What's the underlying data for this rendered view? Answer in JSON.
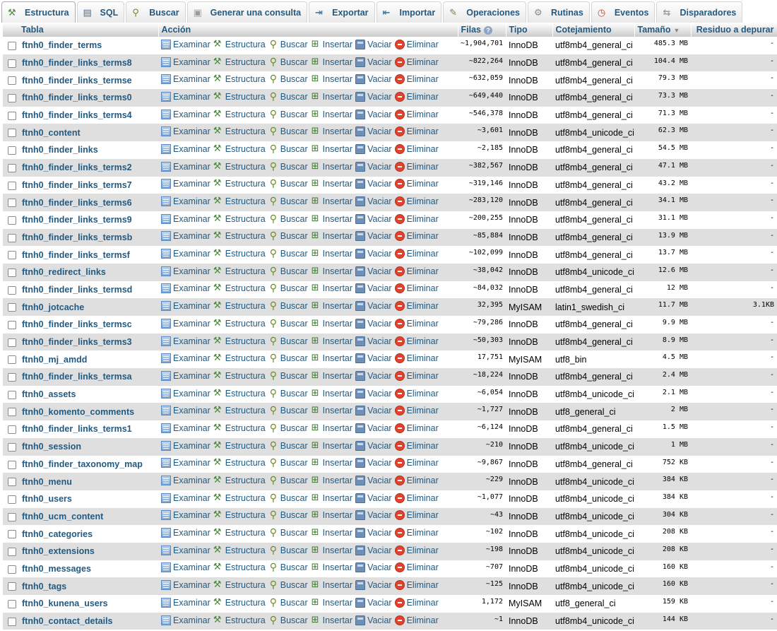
{
  "tabs": [
    {
      "key": "estructura",
      "label": "Estructura",
      "icon": "structure-icon",
      "active": true
    },
    {
      "key": "sql",
      "label": "SQL",
      "icon": "sql-icon",
      "active": false
    },
    {
      "key": "buscar",
      "label": "Buscar",
      "icon": "search-icon",
      "active": false
    },
    {
      "key": "consulta",
      "label": "Generar una consulta",
      "icon": "query-icon",
      "active": false
    },
    {
      "key": "exportar",
      "label": "Exportar",
      "icon": "export-icon",
      "active": false
    },
    {
      "key": "importar",
      "label": "Importar",
      "icon": "import-icon",
      "active": false
    },
    {
      "key": "operaciones",
      "label": "Operaciones",
      "icon": "operations-icon",
      "active": false
    },
    {
      "key": "rutinas",
      "label": "Rutinas",
      "icon": "routines-icon",
      "active": false
    },
    {
      "key": "eventos",
      "label": "Eventos",
      "icon": "events-icon",
      "active": false
    },
    {
      "key": "disparadores",
      "label": "Disparadores",
      "icon": "triggers-icon",
      "active": false
    }
  ],
  "columns": {
    "tabla": "Tabla",
    "accion": "Acción",
    "filas": "Filas",
    "tipo": "Tipo",
    "cotejamiento": "Cotejamiento",
    "tamano": "Tamaño",
    "residuo": "Residuo a depurar"
  },
  "actions": {
    "examinar": "Examinar",
    "estructura": "Estructura",
    "buscar": "Buscar",
    "insertar": "Insertar",
    "vaciar": "Vaciar",
    "eliminar": "Eliminar"
  },
  "rows": [
    {
      "name": "ftnh0_finder_terms",
      "rows": "~1,904,701",
      "type": "InnoDB",
      "collation": "utf8mb4_general_ci",
      "size": "485.3 MB",
      "overhead": "-"
    },
    {
      "name": "ftnh0_finder_links_terms8",
      "rows": "~822,264",
      "type": "InnoDB",
      "collation": "utf8mb4_general_ci",
      "size": "104.4 MB",
      "overhead": "-"
    },
    {
      "name": "ftnh0_finder_links_termse",
      "rows": "~632,059",
      "type": "InnoDB",
      "collation": "utf8mb4_general_ci",
      "size": "79.3 MB",
      "overhead": "-"
    },
    {
      "name": "ftnh0_finder_links_terms0",
      "rows": "~649,440",
      "type": "InnoDB",
      "collation": "utf8mb4_general_ci",
      "size": "73.3 MB",
      "overhead": "-"
    },
    {
      "name": "ftnh0_finder_links_terms4",
      "rows": "~546,378",
      "type": "InnoDB",
      "collation": "utf8mb4_general_ci",
      "size": "71.3 MB",
      "overhead": "-"
    },
    {
      "name": "ftnh0_content",
      "rows": "~3,601",
      "type": "InnoDB",
      "collation": "utf8mb4_unicode_ci",
      "size": "62.3 MB",
      "overhead": "-"
    },
    {
      "name": "ftnh0_finder_links",
      "rows": "~2,185",
      "type": "InnoDB",
      "collation": "utf8mb4_general_ci",
      "size": "54.5 MB",
      "overhead": "-"
    },
    {
      "name": "ftnh0_finder_links_terms2",
      "rows": "~382,567",
      "type": "InnoDB",
      "collation": "utf8mb4_general_ci",
      "size": "47.1 MB",
      "overhead": "-"
    },
    {
      "name": "ftnh0_finder_links_terms7",
      "rows": "~319,146",
      "type": "InnoDB",
      "collation": "utf8mb4_general_ci",
      "size": "43.2 MB",
      "overhead": "-"
    },
    {
      "name": "ftnh0_finder_links_terms6",
      "rows": "~283,120",
      "type": "InnoDB",
      "collation": "utf8mb4_general_ci",
      "size": "34.1 MB",
      "overhead": "-"
    },
    {
      "name": "ftnh0_finder_links_terms9",
      "rows": "~200,255",
      "type": "InnoDB",
      "collation": "utf8mb4_general_ci",
      "size": "31.1 MB",
      "overhead": "-"
    },
    {
      "name": "ftnh0_finder_links_termsb",
      "rows": "~85,884",
      "type": "InnoDB",
      "collation": "utf8mb4_general_ci",
      "size": "13.9 MB",
      "overhead": "-"
    },
    {
      "name": "ftnh0_finder_links_termsf",
      "rows": "~102,099",
      "type": "InnoDB",
      "collation": "utf8mb4_general_ci",
      "size": "13.7 MB",
      "overhead": "-"
    },
    {
      "name": "ftnh0_redirect_links",
      "rows": "~38,042",
      "type": "InnoDB",
      "collation": "utf8mb4_unicode_ci",
      "size": "12.6 MB",
      "overhead": "-"
    },
    {
      "name": "ftnh0_finder_links_termsd",
      "rows": "~84,032",
      "type": "InnoDB",
      "collation": "utf8mb4_general_ci",
      "size": "12 MB",
      "overhead": "-"
    },
    {
      "name": "ftnh0_jotcache",
      "rows": "32,395",
      "type": "MyISAM",
      "collation": "latin1_swedish_ci",
      "size": "11.7 MB",
      "overhead": "3.1KB"
    },
    {
      "name": "ftnh0_finder_links_termsc",
      "rows": "~79,286",
      "type": "InnoDB",
      "collation": "utf8mb4_general_ci",
      "size": "9.9 MB",
      "overhead": "-"
    },
    {
      "name": "ftnh0_finder_links_terms3",
      "rows": "~50,303",
      "type": "InnoDB",
      "collation": "utf8mb4_general_ci",
      "size": "8.9 MB",
      "overhead": "-"
    },
    {
      "name": "ftnh0_mj_amdd",
      "rows": "17,751",
      "type": "MyISAM",
      "collation": "utf8_bin",
      "size": "4.5 MB",
      "overhead": "-"
    },
    {
      "name": "ftnh0_finder_links_termsa",
      "rows": "~18,224",
      "type": "InnoDB",
      "collation": "utf8mb4_general_ci",
      "size": "2.4 MB",
      "overhead": "-"
    },
    {
      "name": "ftnh0_assets",
      "rows": "~6,054",
      "type": "InnoDB",
      "collation": "utf8mb4_unicode_ci",
      "size": "2.1 MB",
      "overhead": "-"
    },
    {
      "name": "ftnh0_komento_comments",
      "rows": "~1,727",
      "type": "InnoDB",
      "collation": "utf8_general_ci",
      "size": "2 MB",
      "overhead": "-"
    },
    {
      "name": "ftnh0_finder_links_terms1",
      "rows": "~6,124",
      "type": "InnoDB",
      "collation": "utf8mb4_general_ci",
      "size": "1.5 MB",
      "overhead": "-"
    },
    {
      "name": "ftnh0_session",
      "rows": "~210",
      "type": "InnoDB",
      "collation": "utf8mb4_unicode_ci",
      "size": "1 MB",
      "overhead": "-"
    },
    {
      "name": "ftnh0_finder_taxonomy_map",
      "rows": "~9,867",
      "type": "InnoDB",
      "collation": "utf8mb4_general_ci",
      "size": "752 KB",
      "overhead": "-"
    },
    {
      "name": "ftnh0_menu",
      "rows": "~229",
      "type": "InnoDB",
      "collation": "utf8mb4_unicode_ci",
      "size": "384 KB",
      "overhead": "-"
    },
    {
      "name": "ftnh0_users",
      "rows": "~1,077",
      "type": "InnoDB",
      "collation": "utf8mb4_unicode_ci",
      "size": "384 KB",
      "overhead": "-"
    },
    {
      "name": "ftnh0_ucm_content",
      "rows": "~43",
      "type": "InnoDB",
      "collation": "utf8mb4_unicode_ci",
      "size": "304 KB",
      "overhead": "-"
    },
    {
      "name": "ftnh0_categories",
      "rows": "~102",
      "type": "InnoDB",
      "collation": "utf8mb4_unicode_ci",
      "size": "208 KB",
      "overhead": "-"
    },
    {
      "name": "ftnh0_extensions",
      "rows": "~198",
      "type": "InnoDB",
      "collation": "utf8mb4_unicode_ci",
      "size": "208 KB",
      "overhead": "-"
    },
    {
      "name": "ftnh0_messages",
      "rows": "~707",
      "type": "InnoDB",
      "collation": "utf8mb4_unicode_ci",
      "size": "160 KB",
      "overhead": "-"
    },
    {
      "name": "ftnh0_tags",
      "rows": "~125",
      "type": "InnoDB",
      "collation": "utf8mb4_unicode_ci",
      "size": "160 KB",
      "overhead": "-"
    },
    {
      "name": "ftnh0_kunena_users",
      "rows": "1,172",
      "type": "MyISAM",
      "collation": "utf8_general_ci",
      "size": "159 KB",
      "overhead": "-"
    },
    {
      "name": "ftnh0_contact_details",
      "rows": "~1",
      "type": "InnoDB",
      "collation": "utf8mb4_unicode_ci",
      "size": "144 KB",
      "overhead": "-"
    }
  ]
}
